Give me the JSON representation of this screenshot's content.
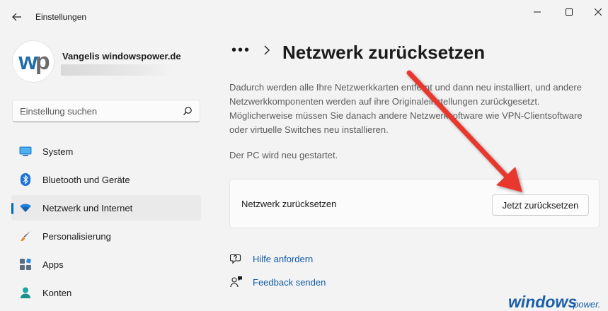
{
  "window": {
    "title": "Einstellungen"
  },
  "profile": {
    "name": "Vangelis windowspower.de",
    "avatar_text": "wp"
  },
  "search": {
    "placeholder": "Einstellung suchen"
  },
  "sidebar": {
    "items": [
      {
        "label": "System",
        "icon": "monitor-icon",
        "active": false
      },
      {
        "label": "Bluetooth und Geräte",
        "icon": "bluetooth-icon",
        "active": false
      },
      {
        "label": "Netzwerk und Internet",
        "icon": "wifi-icon",
        "active": true
      },
      {
        "label": "Personalisierung",
        "icon": "paintbrush-icon",
        "active": false
      },
      {
        "label": "Apps",
        "icon": "apps-icon",
        "active": false
      },
      {
        "label": "Konten",
        "icon": "person-icon",
        "active": false
      }
    ]
  },
  "main": {
    "breadcrumb_more": "•••",
    "title": "Netzwerk zurücksetzen",
    "description": "Dadurch werden alle Ihre Netzwerkkarten entfernt und dann neu installiert, und andere Netzwerkkomponenten werden auf ihre Originaleinstellungen zurückgesetzt. Möglicherweise müssen Sie danach andere Netzwerksoftware wie VPN-Clientsoftware oder virtuelle Switches neu installieren.",
    "restart_note": "Der PC wird neu gestartet.",
    "card": {
      "label": "Netzwerk zurücksetzen",
      "button": "Jetzt zurücksetzen"
    },
    "links": [
      {
        "label": "Hilfe anfordern",
        "icon": "help-icon"
      },
      {
        "label": "Feedback senden",
        "icon": "feedback-icon"
      }
    ]
  },
  "watermark": {
    "text_main": "windows",
    "text_suffix": "power."
  },
  "colors": {
    "accent": "#0067c0",
    "arrow": "#e8382e",
    "link": "#0f5ba8"
  }
}
